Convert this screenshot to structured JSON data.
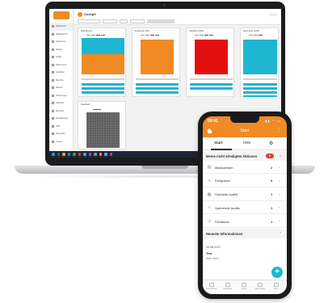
{
  "laptop": {
    "app_title": "Cockpit",
    "sidebar_items": [
      "Dashboard",
      "Maßnahmen",
      "Ereignisse",
      "Risiken",
      "Audits",
      "Dokumente",
      "Aufgaben",
      "Berichte",
      "Wissen",
      "Schulungen",
      "Kalender",
      "Benutzer",
      "Einstellungen",
      "Hilfe",
      "Abmelden",
      "Logout"
    ],
    "cards": [
      {
        "title": "Maßnahmen"
      },
      {
        "title": "Ereignisse offen"
      },
      {
        "title": "Geplante Audits"
      },
      {
        "title": "Sperrende Audits"
      },
      {
        "title": "Feedback"
      }
    ],
    "colors": {
      "orange": "#f08a24",
      "cyan": "#1eb6d0",
      "red": "#e41010",
      "grey": "#5e5e5e"
    }
  },
  "phone": {
    "time": "09:41",
    "status": "▮▮ ◠ ▭",
    "header_title": "Start",
    "tabs": [
      "Start",
      "Hilfe"
    ],
    "section_title": "Meine nicht erledigten Aktionen",
    "section_badge": "8",
    "rows": [
      {
        "label": "Maßnahmen",
        "count": "2",
        "icon": "clipboard-icon"
      },
      {
        "label": "Ereignisse",
        "count": "0",
        "icon": "alert-icon"
      },
      {
        "label": "Geplante Audits",
        "count": "1",
        "icon": "calendar-icon"
      },
      {
        "label": "Sperrende Audits",
        "count": "1",
        "icon": "lock-icon"
      },
      {
        "label": "Feedback",
        "count": "1",
        "icon": "feedback-icon"
      }
    ],
    "news_title": "Neueste Informationen",
    "news_date": "05.08.2021",
    "news_heading": "Test",
    "news_text": "Bitte lesen",
    "bottom_nav": [
      "Maßnahmen",
      "Ereignisse",
      "Audits",
      "Mein Status",
      "Mehr"
    ]
  }
}
